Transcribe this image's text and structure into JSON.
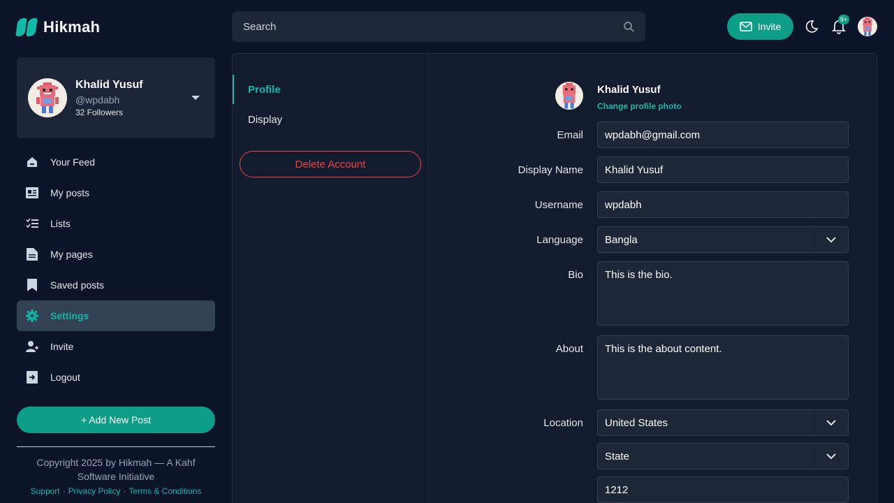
{
  "brand": {
    "name": "Hikmah"
  },
  "profile_card": {
    "name": "Khalid Yusuf",
    "handle": "@wpdabh",
    "followers": "32 Followers"
  },
  "nav": {
    "items": [
      {
        "label": "Your Feed",
        "icon": "home-icon"
      },
      {
        "label": "My posts",
        "icon": "posts-icon"
      },
      {
        "label": "Lists",
        "icon": "list-icon"
      },
      {
        "label": "My pages",
        "icon": "page-icon"
      },
      {
        "label": "Saved posts",
        "icon": "bookmark-icon"
      },
      {
        "label": "Settings",
        "icon": "gear-icon",
        "active": true
      },
      {
        "label": "Invite",
        "icon": "user-plus-icon"
      },
      {
        "label": "Logout",
        "icon": "logout-icon"
      }
    ]
  },
  "add_post": {
    "label": "+ Add New Post"
  },
  "footer": {
    "copyright": "Copyright 2025 by Hikmah — A Kahf Software Initiative",
    "links": [
      "Support",
      "Privacy Policy",
      "Terms & Conditions"
    ]
  },
  "topbar": {
    "search_placeholder": "Search",
    "invite_label": "Invite",
    "notification_count": "9+"
  },
  "settings": {
    "tabs": [
      {
        "label": "Profile",
        "active": true
      },
      {
        "label": "Display"
      }
    ],
    "delete_label": "Delete Account",
    "profile_name": "Khalid Yusuf",
    "change_photo": "Change profile photo",
    "fields": {
      "email": {
        "label": "Email",
        "value": "wpdabh@gmail.com"
      },
      "display_name": {
        "label": "Display Name",
        "value": "Khalid Yusuf"
      },
      "username": {
        "label": "Username",
        "value": "wpdabh"
      },
      "language": {
        "label": "Language",
        "value": "Bangla"
      },
      "bio": {
        "label": "Bio",
        "value": "This is the bio."
      },
      "about": {
        "label": "About",
        "value": "This is the about content."
      },
      "location": {
        "label": "Location",
        "country": "United States",
        "state": "State",
        "zip": "1212"
      }
    }
  },
  "colors": {
    "accent": "#0d9e88",
    "accent_text": "#14b8a6",
    "danger": "#ef4444",
    "background": "#0c1429"
  }
}
